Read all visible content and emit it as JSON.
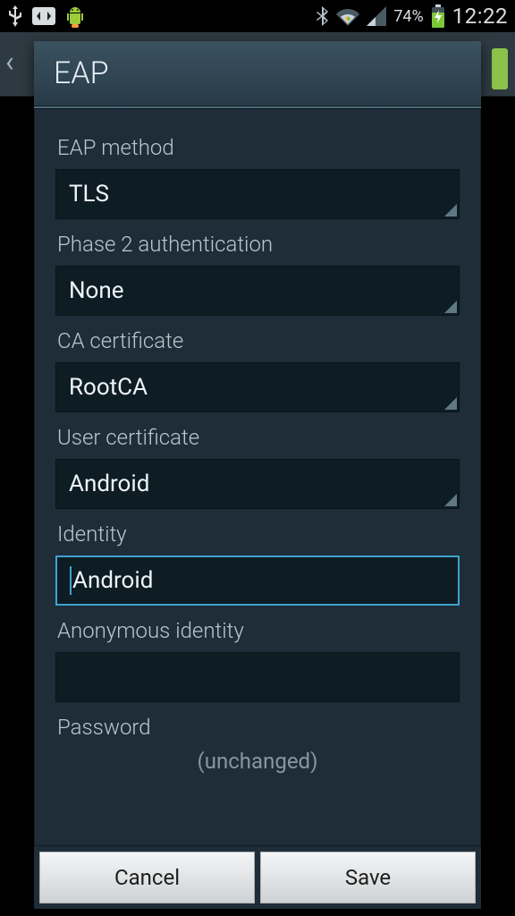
{
  "status": {
    "battery_pct": "74%",
    "time": "12:22"
  },
  "icons": {
    "usb": "usb-icon",
    "sync": "sync-icon",
    "android": "android-icon",
    "bluetooth": "bluetooth-icon",
    "wifi": "wifi-icon",
    "signal": "signal-icon",
    "battery": "battery-charging-icon"
  },
  "dialog": {
    "title": "EAP",
    "fields": {
      "eap_method": {
        "label": "EAP method",
        "value": "TLS"
      },
      "phase2": {
        "label": "Phase 2 authentication",
        "value": "None"
      },
      "ca_cert": {
        "label": "CA certificate",
        "value": "RootCA"
      },
      "user_cert": {
        "label": "User certificate",
        "value": "Android"
      },
      "identity": {
        "label": "Identity",
        "value": "Android"
      },
      "anon_id": {
        "label": "Anonymous identity",
        "value": ""
      },
      "password": {
        "label": "Password",
        "placeholder": "(unchanged)"
      }
    },
    "buttons": {
      "cancel": "Cancel",
      "save": "Save"
    }
  }
}
